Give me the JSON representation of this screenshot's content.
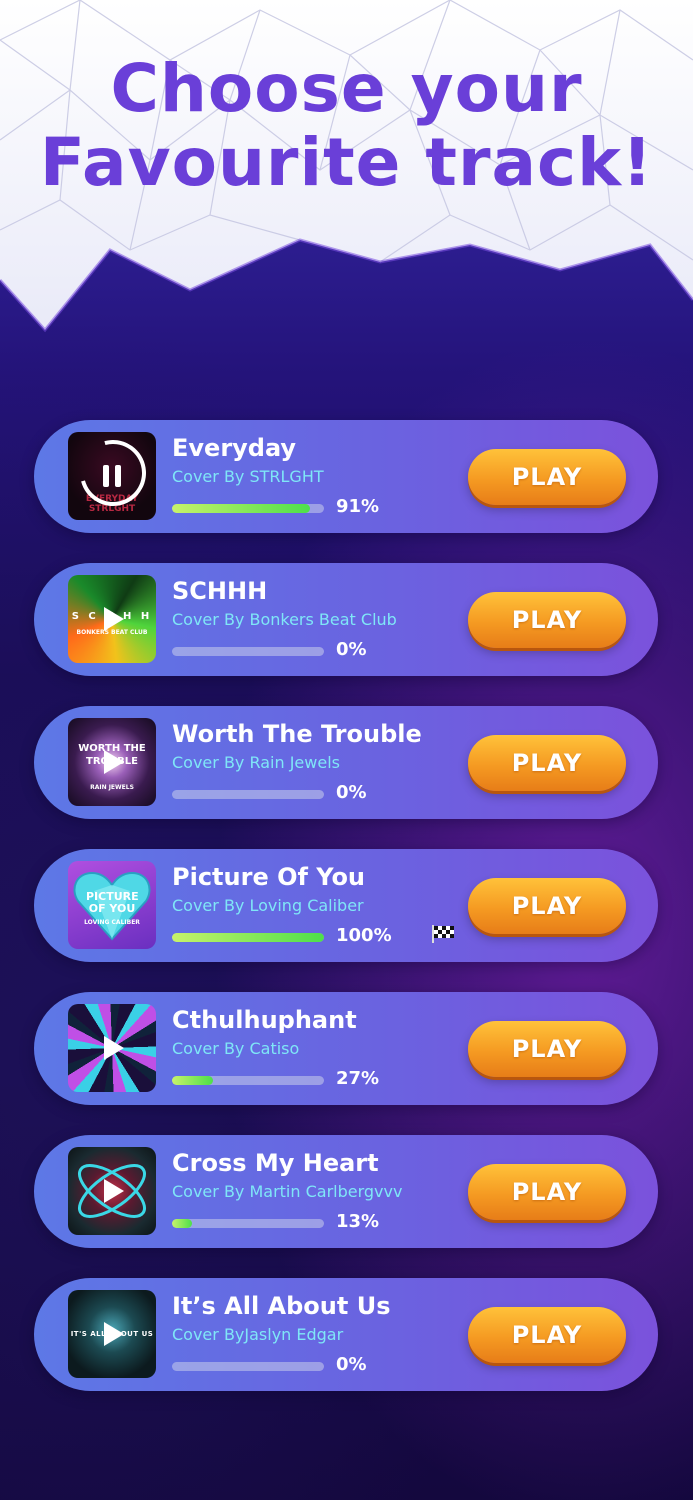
{
  "page": {
    "title": "Choose your Favourite track!",
    "title_line1": "Choose your",
    "title_line2": "Favourite track!"
  },
  "colors": {
    "title": "#6a3fd8",
    "card_gradient_start": "#5d78e6",
    "card_gradient_end": "#7b52dc",
    "subtitle": "#7fe6f7",
    "play_button": "#f59a22",
    "progress_fill": "#4de04a"
  },
  "tracks": [
    {
      "title": "Everyday",
      "subtitle": "Cover By STRLGHT",
      "progress": 91,
      "progress_label": "91%",
      "button_label": "PLAY",
      "state": "playing",
      "cover_icon": "pause-icon",
      "completed": false
    },
    {
      "title": "SCHHH",
      "subtitle": "Cover By Bonkers Beat Club",
      "progress": 0,
      "progress_label": "0%",
      "button_label": "PLAY",
      "state": "idle",
      "cover_icon": "play-icon",
      "completed": false
    },
    {
      "title": "Worth The Trouble",
      "subtitle": "Cover By Rain Jewels",
      "progress": 0,
      "progress_label": "0%",
      "button_label": "PLAY",
      "state": "idle",
      "cover_icon": "play-icon",
      "completed": false
    },
    {
      "title": "Picture Of You",
      "subtitle": "Cover By Loving Caliber",
      "progress": 100,
      "progress_label": "100%",
      "button_label": "PLAY",
      "state": "idle",
      "cover_icon": "none",
      "completed": true,
      "completed_icon": "checkered-flag-icon"
    },
    {
      "title": "Cthulhuphant",
      "subtitle": "Cover By Catiso",
      "progress": 27,
      "progress_label": "27%",
      "button_label": "PLAY",
      "state": "idle",
      "cover_icon": "play-icon",
      "completed": false
    },
    {
      "title": "Cross My Heart",
      "subtitle": "Cover By Martin Carlbergvvv",
      "progress": 13,
      "progress_label": "13%",
      "button_label": "PLAY",
      "state": "idle",
      "cover_icon": "play-icon",
      "completed": false
    },
    {
      "title": "It’s All About Us",
      "subtitle": "Cover ByJaslyn Edgar",
      "progress": 0,
      "progress_label": "0%",
      "button_label": "PLAY",
      "state": "idle",
      "cover_icon": "play-icon",
      "completed": false
    }
  ],
  "cover_art_text": {
    "everyday": "EVERYDAY STRLGHT",
    "schhh": "S C H H H",
    "schhh_sub": "BONKERS BEAT CLUB",
    "worth": "WORTH THE TROUBLE",
    "worth_sub": "RAIN JEWELS",
    "picture": "PICTURE OF YOU",
    "picture_sub": "LOVING CALIBER",
    "itsall": "IT'S ALL ABOUT US"
  }
}
